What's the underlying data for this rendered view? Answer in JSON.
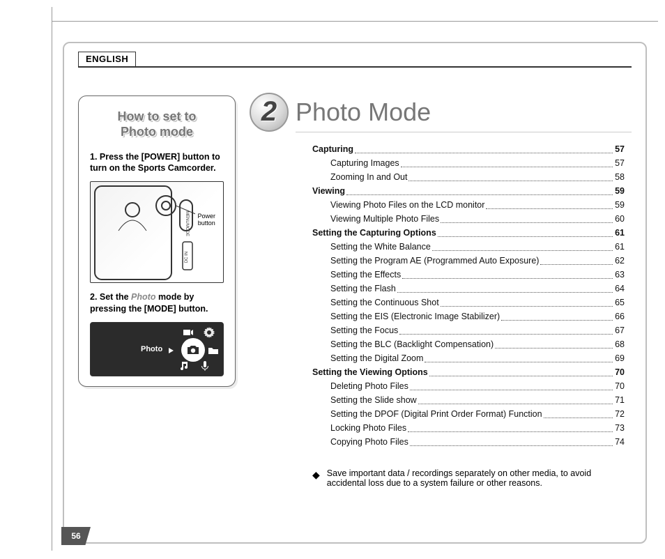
{
  "lang": "ENGLISH",
  "page_number": "56",
  "sidebar": {
    "title_l1": "How to set to",
    "title_l2": "Photo mode",
    "step1_prefix": "1.  Press the [POWER] button to turn on the Sports Camcorder.",
    "step2_a": "2.  Set the ",
    "step2_em": "Photo",
    "step2_b": " mode by pressing the [MODE] button.",
    "power_label_l1": "Power",
    "power_label_l2": "button",
    "menu_label": "MENU",
    "mode_label": "MODE",
    "dcin_label": "DC IN",
    "modebar_label": "Photo"
  },
  "chapter": {
    "number": "2",
    "title": "Photo Mode"
  },
  "toc": [
    {
      "level": 0,
      "label": "Capturing",
      "page": "57"
    },
    {
      "level": 1,
      "label": "Capturing Images",
      "page": "57"
    },
    {
      "level": 1,
      "label": "Zooming In and Out",
      "page": "58"
    },
    {
      "level": 0,
      "label": "Viewing",
      "page": "59"
    },
    {
      "level": 1,
      "label": "Viewing Photo Files on the LCD monitor",
      "page": "59"
    },
    {
      "level": 1,
      "label": "Viewing Multiple Photo Files",
      "page": "60"
    },
    {
      "level": 0,
      "label": "Setting the Capturing Options",
      "page": "61"
    },
    {
      "level": 1,
      "label": "Setting the White Balance",
      "page": "61"
    },
    {
      "level": 1,
      "label": "Setting the Program AE (Programmed Auto Exposure)",
      "page": "62"
    },
    {
      "level": 1,
      "label": "Setting the Effects",
      "page": "63"
    },
    {
      "level": 1,
      "label": "Setting the Flash",
      "page": "64"
    },
    {
      "level": 1,
      "label": "Setting the Continuous Shot",
      "page": "65"
    },
    {
      "level": 1,
      "label": "Setting the EIS (Electronic Image Stabilizer)",
      "page": "66"
    },
    {
      "level": 1,
      "label": "Setting the Focus",
      "page": "67"
    },
    {
      "level": 1,
      "label": "Setting the BLC (Backlight Compensation)",
      "page": "68"
    },
    {
      "level": 1,
      "label": "Setting the Digital Zoom",
      "page": "69"
    },
    {
      "level": 0,
      "label": "Setting the Viewing Options",
      "page": "70"
    },
    {
      "level": 1,
      "label": "Deleting Photo Files",
      "page": "70"
    },
    {
      "level": 1,
      "label": "Setting the Slide show",
      "page": "71"
    },
    {
      "level": 1,
      "label": "Setting the DPOF (Digital Print Order Format) Function",
      "page": "72"
    },
    {
      "level": 1,
      "label": "Locking Photo Files",
      "page": "73"
    },
    {
      "level": 1,
      "label": "Copying Photo Files",
      "page": "74"
    }
  ],
  "note": "Save important data / recordings separately on other media, to avoid accidental loss due to a system failure or other reasons."
}
